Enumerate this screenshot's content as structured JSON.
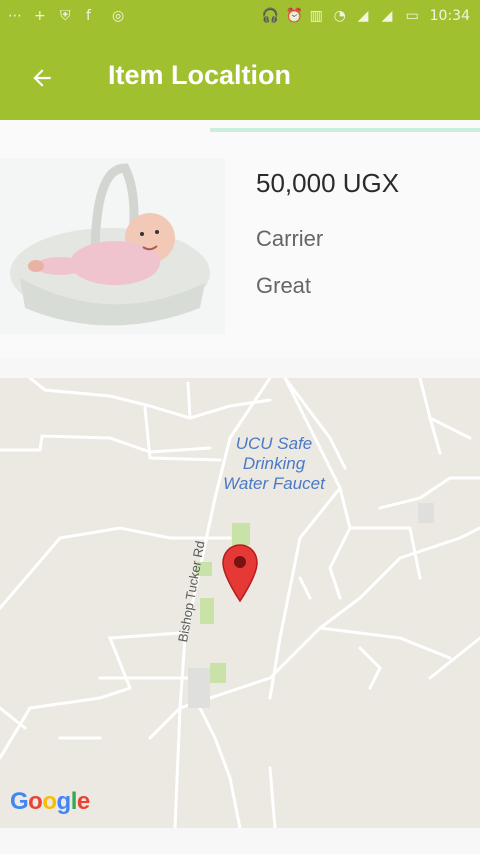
{
  "statusbar": {
    "left_icons": [
      "dots-icon",
      "plus-icon",
      "shield-icon",
      "facebook-icon",
      "camera-icon"
    ],
    "right_icons": [
      "headphone-icon",
      "alarm-icon",
      "vibrate-icon",
      "wifi-icon",
      "signal-icon",
      "signal-icon",
      "battery-icon"
    ],
    "time": "10:34"
  },
  "appbar": {
    "title": "Item Localtion",
    "color": "#a1c030"
  },
  "item": {
    "price": "50,000 UGX",
    "name": "Carrier",
    "condition": "Great",
    "photo": "baby-in-basket-image"
  },
  "map": {
    "poi_lines": [
      "UCU Safe",
      "Drinking",
      "Water Faucet"
    ],
    "road_label": "Bishop Tucker Rd",
    "logo": "Google",
    "marker_color": "#e53935"
  }
}
